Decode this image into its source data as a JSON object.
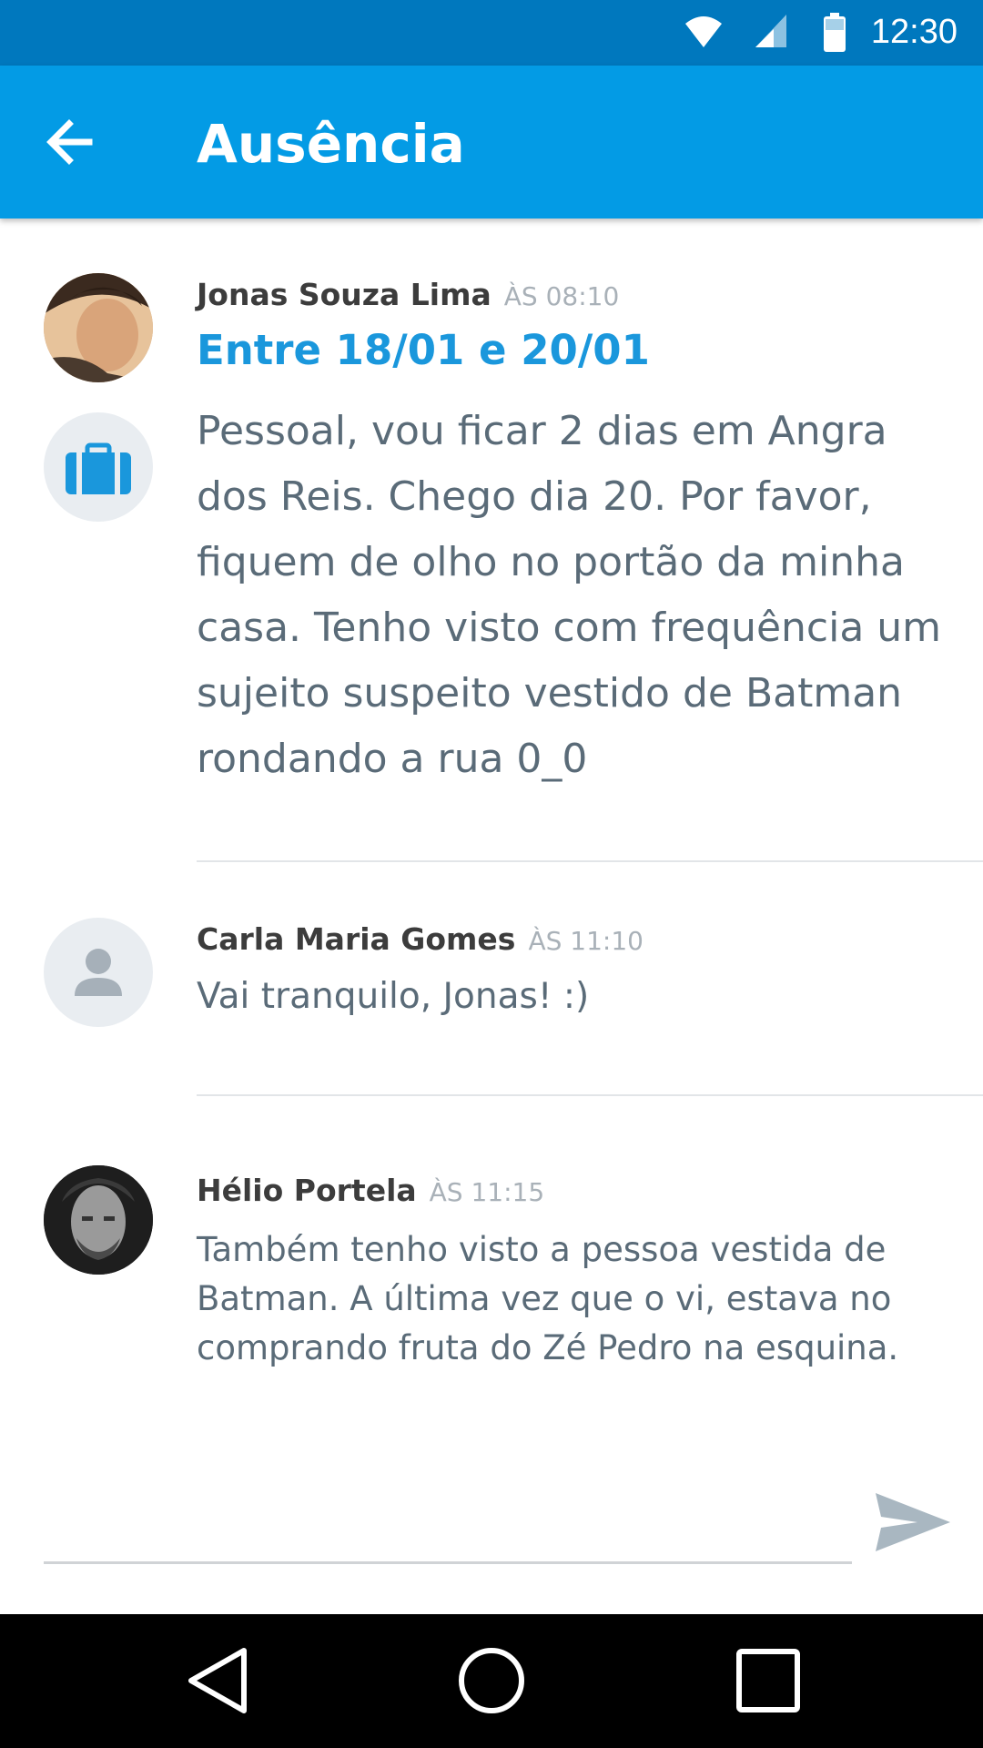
{
  "status_bar": {
    "time": "12:30",
    "icons": [
      "wifi-icon",
      "signal-icon",
      "battery-icon"
    ]
  },
  "app_bar": {
    "title": "Ausência",
    "back_icon": "arrow-back-icon"
  },
  "posts": [
    {
      "author": "Jonas Souza Lima",
      "time": "ÀS 08:10",
      "dates": "Entre 18/01 e 20/01",
      "message_lines": [
        "Pessoal, vou ficar 2 dias em Angra",
        "dos Reis. Chego dia 20. Por favor,",
        "fiquem de olho no portão da minha",
        "casa. Tenho visto com frequência um",
        "sujeito suspeito vestido de Batman",
        "rondando a rua 0_0"
      ],
      "category_icon": "suitcase-icon"
    },
    {
      "author": "Carla Maria Gomes",
      "time": "ÀS 11:10",
      "message": "Vai tranquilo, Jonas! :)"
    },
    {
      "author": "Hélio Portela",
      "time": "ÀS 11:15",
      "message_lines": [
        "Também tenho visto a pessoa vestida de",
        "Batman. A última vez que o vi, estava no",
        "comprando fruta do Zé Pedro na esquina."
      ]
    }
  ],
  "composer": {
    "value": "",
    "send_icon": "send-icon"
  },
  "nav_bar": {
    "icons": [
      "back-triangle-icon",
      "home-circle-icon",
      "recents-square-icon"
    ]
  },
  "colors": {
    "status_bar": "#0078BE",
    "app_bar": "#039BE5",
    "accent_blue": "#1A97DC",
    "message_text": "#5a6b78",
    "author_text": "#3c3c3c",
    "time_text": "#a9b1b8"
  }
}
